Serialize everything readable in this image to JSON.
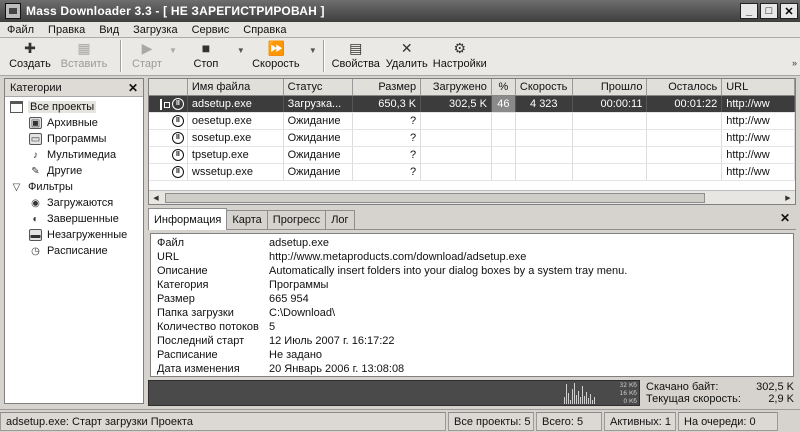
{
  "window": {
    "title": "Mass Downloader 3.3  - [ НЕ ЗАРЕГИСТРИРОВАН ]",
    "min": "_",
    "max": "□",
    "close": "✕"
  },
  "menu": [
    "Файл",
    "Правка",
    "Вид",
    "Загрузка",
    "Сервис",
    "Справка"
  ],
  "toolbar": {
    "create": "Создать",
    "paste": "Вставить",
    "start": "Старт",
    "stop": "Стоп",
    "speed": "Скорость",
    "properties": "Свойства",
    "delete": "Удалить",
    "settings": "Настройки"
  },
  "sidebar": {
    "title": "Категории",
    "close": "✕",
    "items": [
      {
        "label": "Все проекты"
      },
      {
        "label": "Архивные"
      },
      {
        "label": "Программы"
      },
      {
        "label": "Мультимедиа"
      },
      {
        "label": "Другие"
      },
      {
        "label": "Фильтры"
      },
      {
        "label": "Загружаются"
      },
      {
        "label": "Завершенные"
      },
      {
        "label": "Незагруженные"
      },
      {
        "label": "Расписание"
      }
    ]
  },
  "table": {
    "headers": [
      "Имя файла",
      "Статус",
      "Размер",
      "Загружено",
      "%",
      "Скорость",
      "Прошло",
      "Осталось",
      "URL"
    ],
    "rows": [
      {
        "name": "adsetup.exe",
        "status": "Загрузка...",
        "size": "650,3 K",
        "loaded": "302,5 K",
        "pct": "46",
        "speed": "4 323",
        "elapsed": "00:00:11",
        "remaining": "00:01:22",
        "url": "http://ww"
      },
      {
        "name": "oesetup.exe",
        "status": "Ожидание",
        "size": "?",
        "loaded": "",
        "pct": "",
        "speed": "",
        "elapsed": "",
        "remaining": "",
        "url": "http://ww"
      },
      {
        "name": "sosetup.exe",
        "status": "Ожидание",
        "size": "?",
        "loaded": "",
        "pct": "",
        "speed": "",
        "elapsed": "",
        "remaining": "",
        "url": "http://ww"
      },
      {
        "name": "tpsetup.exe",
        "status": "Ожидание",
        "size": "?",
        "loaded": "",
        "pct": "",
        "speed": "",
        "elapsed": "",
        "remaining": "",
        "url": "http://ww"
      },
      {
        "name": "wssetup.exe",
        "status": "Ожидание",
        "size": "?",
        "loaded": "",
        "pct": "",
        "speed": "",
        "elapsed": "",
        "remaining": "",
        "url": "http://ww"
      }
    ]
  },
  "tabs": [
    "Информация",
    "Карта",
    "Прогресс",
    "Лог"
  ],
  "info_close": "✕",
  "info": [
    {
      "label": "Файл",
      "value": "adsetup.exe"
    },
    {
      "label": "URL",
      "value": "http://www.metaproducts.com/download/adsetup.exe"
    },
    {
      "label": "Описание",
      "value": "Automatically insert  folders into your dialog boxes by a system tray menu."
    },
    {
      "label": "Категория",
      "value": "Программы"
    },
    {
      "label": "Размер",
      "value": "665 954"
    },
    {
      "label": "Папка загрузки",
      "value": "C:\\Download\\"
    },
    {
      "label": "Количество потоков",
      "value": "5"
    },
    {
      "label": "Последний старт",
      "value": "12 Июль 2007 г. 16:17:22"
    },
    {
      "label": "Расписание",
      "value": "Не задано"
    },
    {
      "label": "Дата изменения",
      "value": "20 Январь 2006 г. 13:08:08"
    }
  ],
  "graph": {
    "label_top": "32 Кб",
    "label_mid": "16 Кб",
    "label_bot": "0 Кб",
    "levels": [
      0.3,
      0.9,
      0.5,
      0.2,
      0.7,
      0.95,
      0.4,
      0.6,
      0.3,
      0.8,
      0.35,
      0.55,
      0.25,
      0.45,
      0.2,
      0.3
    ]
  },
  "speed_stats": {
    "downloaded_label": "Скачано байт:",
    "downloaded_value": "302,5 K",
    "speed_label": "Текущая скорость:",
    "speed_value": "2,9 K"
  },
  "status": {
    "message": "adsetup.exe: Старт загрузки Проекта",
    "all_projects": "Все проекты: 5",
    "total": "Всего: 5",
    "active": "Активных: 1",
    "queued": "На очереди: 0"
  }
}
